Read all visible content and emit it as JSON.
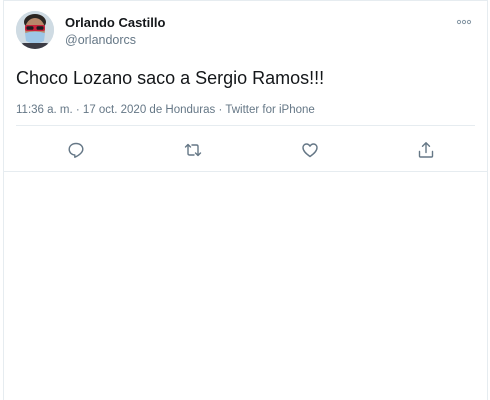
{
  "tweet": {
    "author": {
      "display_name": "Orlando Castillo",
      "handle": "@orlandorcs"
    },
    "text": "Choco Lozano saco a Sergio Ramos!!!",
    "meta": {
      "time": "11:36 a. m.",
      "separator": " · ",
      "date": "17 oct. 2020",
      "location_prefix": " de ",
      "location": "Honduras",
      "source": "Twitter for iPhone"
    },
    "actions": [
      {
        "icon": "reply-icon"
      },
      {
        "icon": "retweet-icon"
      },
      {
        "icon": "like-icon"
      },
      {
        "icon": "share-icon"
      }
    ],
    "colors": {
      "text": "#14171a",
      "secondary": "#657786",
      "divider": "#e6ecf0",
      "icon": "#657786"
    }
  }
}
